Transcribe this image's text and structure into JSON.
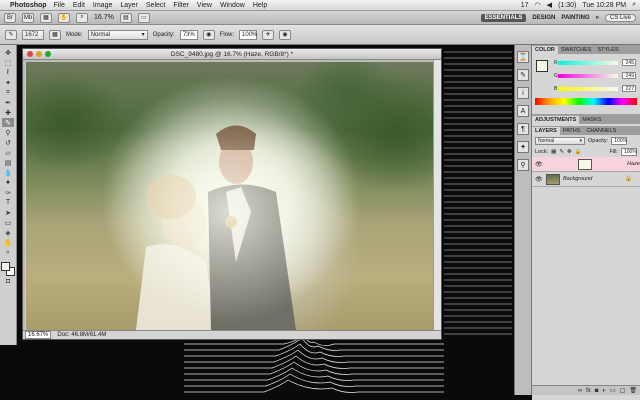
{
  "menubar": {
    "app": "Photoshop",
    "items": [
      "File",
      "Edit",
      "Image",
      "Layer",
      "Select",
      "Filter",
      "View",
      "Window",
      "Help"
    ],
    "clock": "Tue 10:28 PM",
    "battery": "(1:30)",
    "extra": "17"
  },
  "appbar": {
    "zoom": "16.7%",
    "workspaces": [
      "ESSENTIALS",
      "DESIGN",
      "PAINTING"
    ],
    "more": "»",
    "cslive": "CS Live"
  },
  "options": {
    "brush_size": "1672",
    "mode_label": "Mode:",
    "mode_value": "Normal",
    "opacity_label": "Opacity:",
    "opacity_value": "73%",
    "flow_label": "Flow:",
    "flow_value": "100%"
  },
  "document": {
    "title": "DSC_9480.jpg @ 16.7% (Haze, RGB/8*) *",
    "zoom": "16.67%",
    "doc_size": "Doc: 46.8M/61.4M"
  },
  "color_panel": {
    "tabs": [
      "COLOR",
      "SWATCHES",
      "STYLES"
    ],
    "r": "245",
    "g": "249",
    "b": "227"
  },
  "adjustments": {
    "tabs": [
      "ADJUSTMENTS",
      "MASKS"
    ]
  },
  "layers_panel": {
    "tabs": [
      "LAYERS",
      "PATHS",
      "CHANNELS"
    ],
    "blend": "Normal",
    "opacity_label": "Opacity:",
    "opacity": "100%",
    "lock_label": "Lock:",
    "fill_label": "Fill:",
    "fill": "100%",
    "layers": [
      {
        "name": "Haze"
      },
      {
        "name": "Background"
      }
    ]
  },
  "colors": {
    "accent": "#f7d3dc"
  }
}
